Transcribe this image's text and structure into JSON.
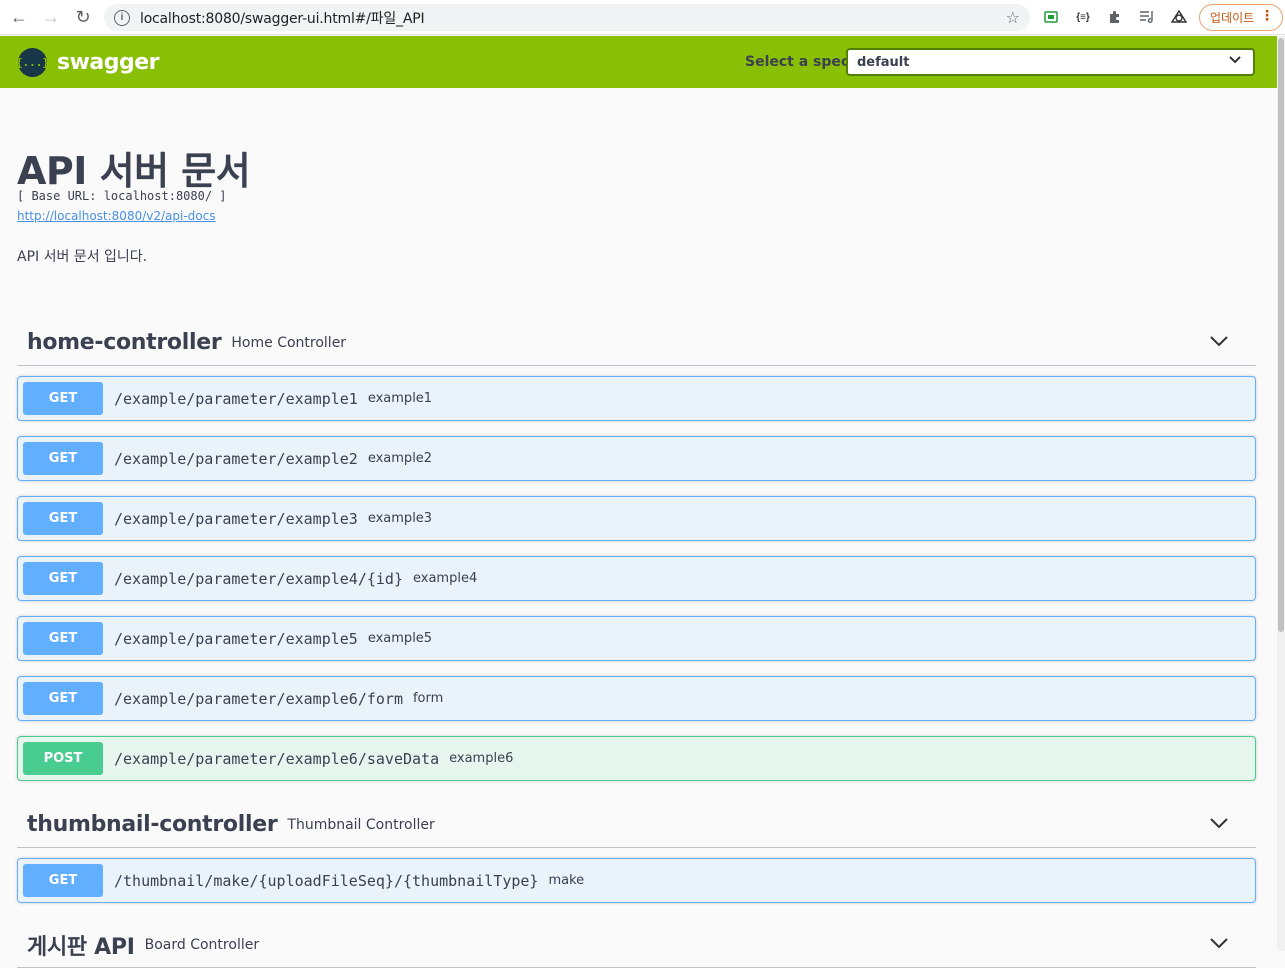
{
  "browser": {
    "url": "localhost:8080/swagger-ui.html#/파일_API",
    "update_label": "업데이트"
  },
  "topbar": {
    "logo_glyph": "{...}",
    "logo_text": "swagger",
    "spec_label": "Select a spec",
    "spec_value": "default"
  },
  "info": {
    "title": "API 서버 문서",
    "base_url": "[ Base URL: localhost:8080/ ]",
    "docs_link": "http://localhost:8080/v2/api-docs",
    "description": "API 서버 문서 입니다."
  },
  "tags": [
    {
      "name": "home-controller",
      "description": "Home Controller",
      "operations": [
        {
          "method": "GET",
          "path": "/example/parameter/example1",
          "summary": "example1"
        },
        {
          "method": "GET",
          "path": "/example/parameter/example2",
          "summary": "example2"
        },
        {
          "method": "GET",
          "path": "/example/parameter/example3",
          "summary": "example3"
        },
        {
          "method": "GET",
          "path": "/example/parameter/example4/{id}",
          "summary": "example4"
        },
        {
          "method": "GET",
          "path": "/example/parameter/example5",
          "summary": "example5"
        },
        {
          "method": "GET",
          "path": "/example/parameter/example6/form",
          "summary": "form"
        },
        {
          "method": "POST",
          "path": "/example/parameter/example6/saveData",
          "summary": "example6"
        }
      ]
    },
    {
      "name": "thumbnail-controller",
      "description": "Thumbnail Controller",
      "operations": [
        {
          "method": "GET",
          "path": "/thumbnail/make/{uploadFileSeq}/{thumbnailType}",
          "summary": "make"
        }
      ]
    },
    {
      "name": "게시판 API",
      "description": "Board Controller",
      "operations": []
    }
  ],
  "colors": {
    "topbar": "#89bf04",
    "get": "#61affe",
    "post": "#49cc90",
    "text": "#3b4151"
  }
}
